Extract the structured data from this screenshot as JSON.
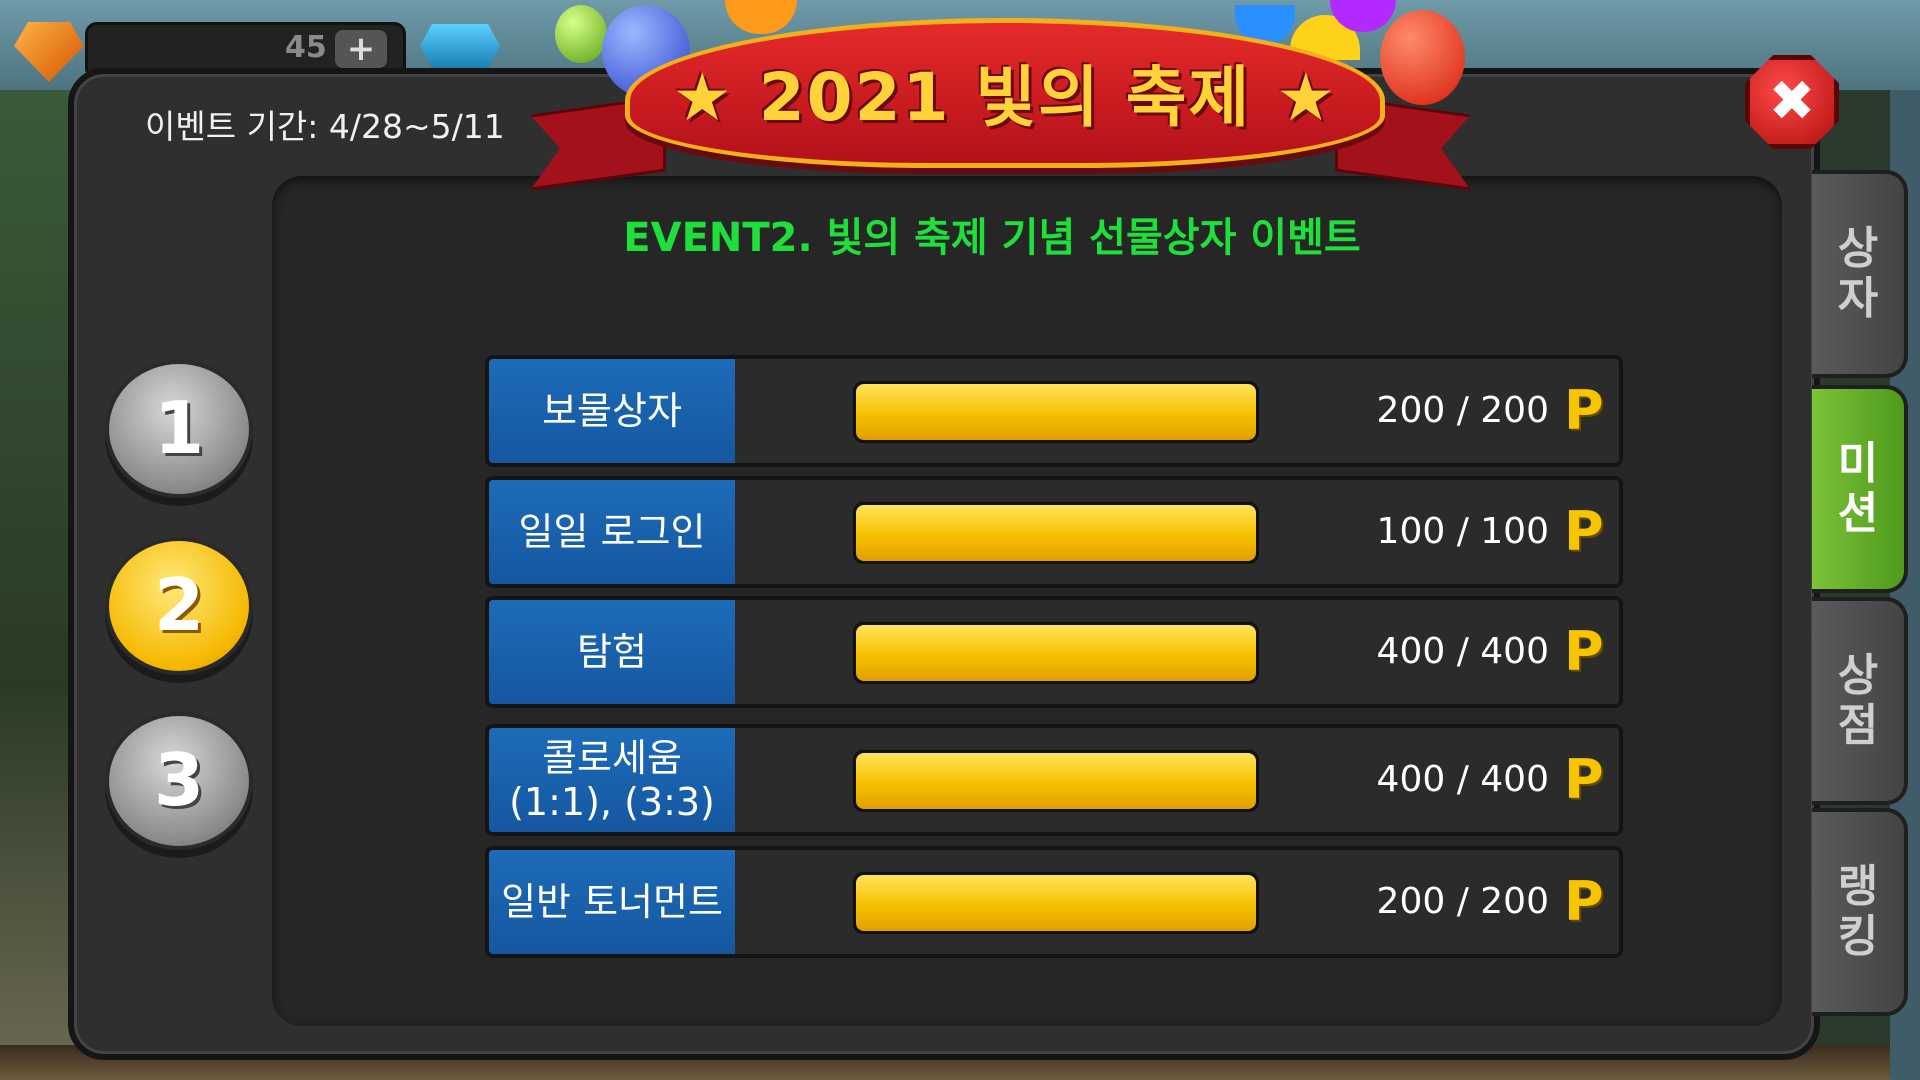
{
  "hud": {
    "count": "45",
    "plus_label": "+"
  },
  "event": {
    "period_label": "이벤트 기간: 4/28~5/11",
    "banner_title": "★ 2021 빛의 축제 ★",
    "subtitle": "EVENT2. 빛의 축제 기념 선물상자 이벤트"
  },
  "close_label": "✖",
  "event_buttons": [
    {
      "label": "1",
      "active": false
    },
    {
      "label": "2",
      "active": true
    },
    {
      "label": "3",
      "active": false
    }
  ],
  "missions": [
    {
      "name": "보물상자",
      "current": 200,
      "max": 200,
      "value_text": "200 / 200",
      "unit": "P",
      "progress": 1.0
    },
    {
      "name": "일일 로그인",
      "current": 100,
      "max": 100,
      "value_text": "100 / 100",
      "unit": "P",
      "progress": 1.0
    },
    {
      "name": "탐험",
      "current": 400,
      "max": 400,
      "value_text": "400 / 400",
      "unit": "P",
      "progress": 1.0
    },
    {
      "name": "콜로세움\n(1:1), (3:3)",
      "current": 400,
      "max": 400,
      "value_text": "400 / 400",
      "unit": "P",
      "progress": 1.0
    },
    {
      "name": "일반 토너먼트",
      "current": 200,
      "max": 200,
      "value_text": "200 / 200",
      "unit": "P",
      "progress": 1.0
    }
  ],
  "side_tabs": [
    {
      "label": "상\n자",
      "active": false
    },
    {
      "label": "미\n션",
      "active": true
    },
    {
      "label": "상\n점",
      "active": false
    },
    {
      "label": "랭\n킹",
      "active": false
    }
  ],
  "colors": {
    "accent_green": "#1fe03a",
    "progress_yellow": "#f6c000",
    "label_blue": "#1d6bb8",
    "active_tab_green": "#5fa82a"
  }
}
